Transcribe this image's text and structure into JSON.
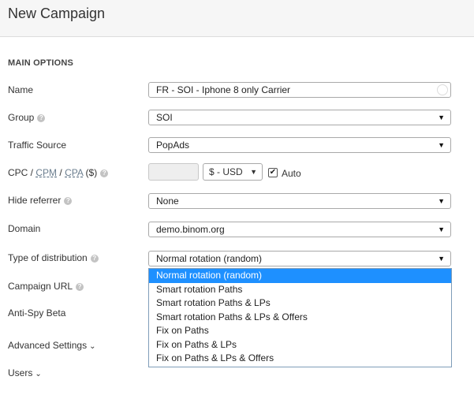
{
  "header": {
    "title": "New Campaign"
  },
  "section": {
    "title": "MAIN OPTIONS"
  },
  "fields": {
    "name": {
      "label": "Name",
      "value": "FR - SOI - Iphone 8 only Carrier"
    },
    "group": {
      "label": "Group",
      "value": "SOI"
    },
    "traffic_source": {
      "label": "Traffic Source",
      "value": "PopAds"
    },
    "cpc": {
      "label_prefix": "CPC /",
      "cpm": "CPM",
      "slash": "/",
      "cpa": "CPA",
      "label_suffix": "($)",
      "currency": "$ - USD",
      "auto_label": "Auto",
      "auto_checked": true
    },
    "hide_referrer": {
      "label": "Hide referrer",
      "value": "None"
    },
    "domain": {
      "label": "Domain",
      "value": "demo.binom.org"
    },
    "distribution": {
      "label": "Type of distribution",
      "value": "Normal rotation (random)",
      "options": [
        "Normal rotation (random)",
        "Smart rotation Paths",
        "Smart rotation Paths & LPs",
        "Smart rotation Paths & LPs & Offers",
        "Fix on Paths",
        "Fix on Paths & LPs",
        "Fix on Paths & LPs & Offers"
      ]
    },
    "campaign_url": {
      "label": "Campaign URL"
    },
    "anti_spy": {
      "label": "Anti-Spy Beta"
    }
  },
  "advanced": {
    "label": "Advanced Settings"
  },
  "users": {
    "label": "Users"
  },
  "icons": {
    "help": "?",
    "caret": "▼",
    "chevron": "⌄",
    "check": "✔"
  }
}
